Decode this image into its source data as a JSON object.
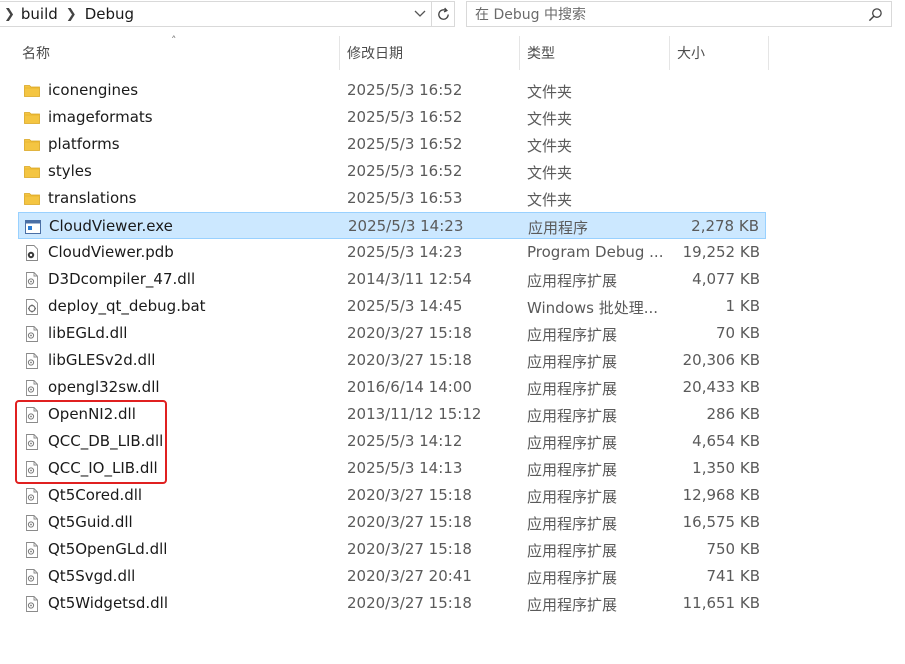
{
  "address": {
    "breadcrumbs": [
      "build",
      "Debug"
    ]
  },
  "search": {
    "placeholder": "在 Debug 中搜索"
  },
  "columns": {
    "name": "名称",
    "modified": "修改日期",
    "type": "类型",
    "size": "大小"
  },
  "files": [
    {
      "name": "iconengines",
      "date": "2025/5/3 16:52",
      "type": "文件夹",
      "size": "",
      "icon": "folder-icon"
    },
    {
      "name": "imageformats",
      "date": "2025/5/3 16:52",
      "type": "文件夹",
      "size": "",
      "icon": "folder-icon"
    },
    {
      "name": "platforms",
      "date": "2025/5/3 16:52",
      "type": "文件夹",
      "size": "",
      "icon": "folder-icon"
    },
    {
      "name": "styles",
      "date": "2025/5/3 16:52",
      "type": "文件夹",
      "size": "",
      "icon": "folder-icon"
    },
    {
      "name": "translations",
      "date": "2025/5/3 16:53",
      "type": "文件夹",
      "size": "",
      "icon": "folder-icon"
    },
    {
      "name": "CloudViewer.exe",
      "date": "2025/5/3 14:23",
      "type": "应用程序",
      "size": "2,278 KB",
      "icon": "exe-icon"
    },
    {
      "name": "CloudViewer.pdb",
      "date": "2025/5/3 14:23",
      "type": "Program Debug ...",
      "size": "19,252 KB",
      "icon": "pdb-icon"
    },
    {
      "name": "D3Dcompiler_47.dll",
      "date": "2014/3/11 12:54",
      "type": "应用程序扩展",
      "size": "4,077 KB",
      "icon": "dll-icon"
    },
    {
      "name": "deploy_qt_debug.bat",
      "date": "2025/5/3 14:45",
      "type": "Windows 批处理...",
      "size": "1 KB",
      "icon": "bat-icon"
    },
    {
      "name": "libEGLd.dll",
      "date": "2020/3/27 15:18",
      "type": "应用程序扩展",
      "size": "70 KB",
      "icon": "dll-icon"
    },
    {
      "name": "libGLESv2d.dll",
      "date": "2020/3/27 15:18",
      "type": "应用程序扩展",
      "size": "20,306 KB",
      "icon": "dll-icon"
    },
    {
      "name": "opengl32sw.dll",
      "date": "2016/6/14 14:00",
      "type": "应用程序扩展",
      "size": "20,433 KB",
      "icon": "dll-icon"
    },
    {
      "name": "OpenNI2.dll",
      "date": "2013/11/12 15:12",
      "type": "应用程序扩展",
      "size": "286 KB",
      "icon": "dll-icon"
    },
    {
      "name": "QCC_DB_LIB.dll",
      "date": "2025/5/3 14:12",
      "type": "应用程序扩展",
      "size": "4,654 KB",
      "icon": "dll-icon"
    },
    {
      "name": "QCC_IO_LIB.dll",
      "date": "2025/5/3 14:13",
      "type": "应用程序扩展",
      "size": "1,350 KB",
      "icon": "dll-icon"
    },
    {
      "name": "Qt5Cored.dll",
      "date": "2020/3/27 15:18",
      "type": "应用程序扩展",
      "size": "12,968 KB",
      "icon": "dll-icon"
    },
    {
      "name": "Qt5Guid.dll",
      "date": "2020/3/27 15:18",
      "type": "应用程序扩展",
      "size": "16,575 KB",
      "icon": "dll-icon"
    },
    {
      "name": "Qt5OpenGLd.dll",
      "date": "2020/3/27 15:18",
      "type": "应用程序扩展",
      "size": "750 KB",
      "icon": "dll-icon"
    },
    {
      "name": "Qt5Svgd.dll",
      "date": "2020/3/27 20:41",
      "type": "应用程序扩展",
      "size": "741 KB",
      "icon": "dll-icon"
    },
    {
      "name": "Qt5Widgetsd.dll",
      "date": "2020/3/27 15:18",
      "type": "应用程序扩展",
      "size": "11,651 KB",
      "icon": "dll-icon"
    }
  ],
  "selected_file": "CloudViewer.exe",
  "colors": {
    "selection_bg": "#cce8ff",
    "selection_border": "#99d1ff",
    "folder": "#f4c542",
    "annotation": "#e02020"
  }
}
